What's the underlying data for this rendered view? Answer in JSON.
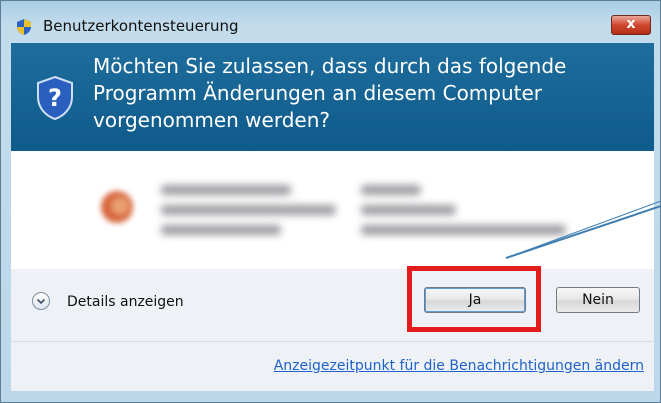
{
  "window": {
    "title": "Benutzerkontensteuerung",
    "close_label": "x"
  },
  "header": {
    "question": "Möchten Sie zulassen, dass durch das folgende Programm Änderungen an diesem Computer vorgenommen werden?"
  },
  "footer": {
    "details_label": "Details anzeigen",
    "yes_label": "Ja",
    "no_label": "Nein",
    "link_label": "Anzeigezeitpunkt für die Benachrichtigungen ändern"
  },
  "colors": {
    "header_blue": "#15649a",
    "highlight_red": "#e31b1b",
    "arrow_blue": "#3f7fb2"
  }
}
